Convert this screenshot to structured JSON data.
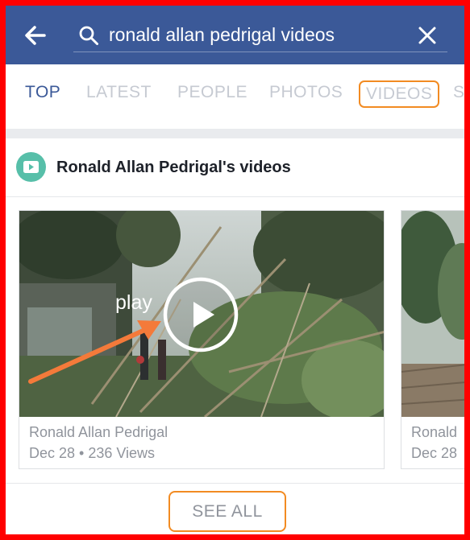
{
  "colors": {
    "header_bg": "#3b5998",
    "active_tab": "#3b5998",
    "inactive_tab": "#c6cad2",
    "highlight": "#f28b22",
    "annotation_frame": "#ff0000",
    "video_badge": "#57bfa9",
    "meta_text": "#90949c"
  },
  "search": {
    "query": "ronald allan pedrigal videos",
    "back_icon": "arrow-left-icon",
    "search_icon": "search-icon",
    "clear_icon": "close-icon"
  },
  "tabs": [
    {
      "label": "TOP",
      "active": true
    },
    {
      "label": "LATEST",
      "active": false
    },
    {
      "label": "PEOPLE",
      "active": false
    },
    {
      "label": "PHOTOS",
      "active": false
    },
    {
      "label": "VIDEOS",
      "active": false,
      "highlighted": true
    },
    {
      "label": "S",
      "active": false
    }
  ],
  "section": {
    "title": "Ronald Allan Pedrigal's videos",
    "icon": "video-play-icon"
  },
  "videos": [
    {
      "author": "Ronald Allan Pedrigal",
      "meta": "Dec 28 • 236 Views",
      "play_icon": "play-icon"
    },
    {
      "author": "Ronald",
      "meta": "Dec 28"
    }
  ],
  "annotation": {
    "play_label": "play"
  },
  "footer": {
    "see_all_label": "SEE ALL"
  }
}
